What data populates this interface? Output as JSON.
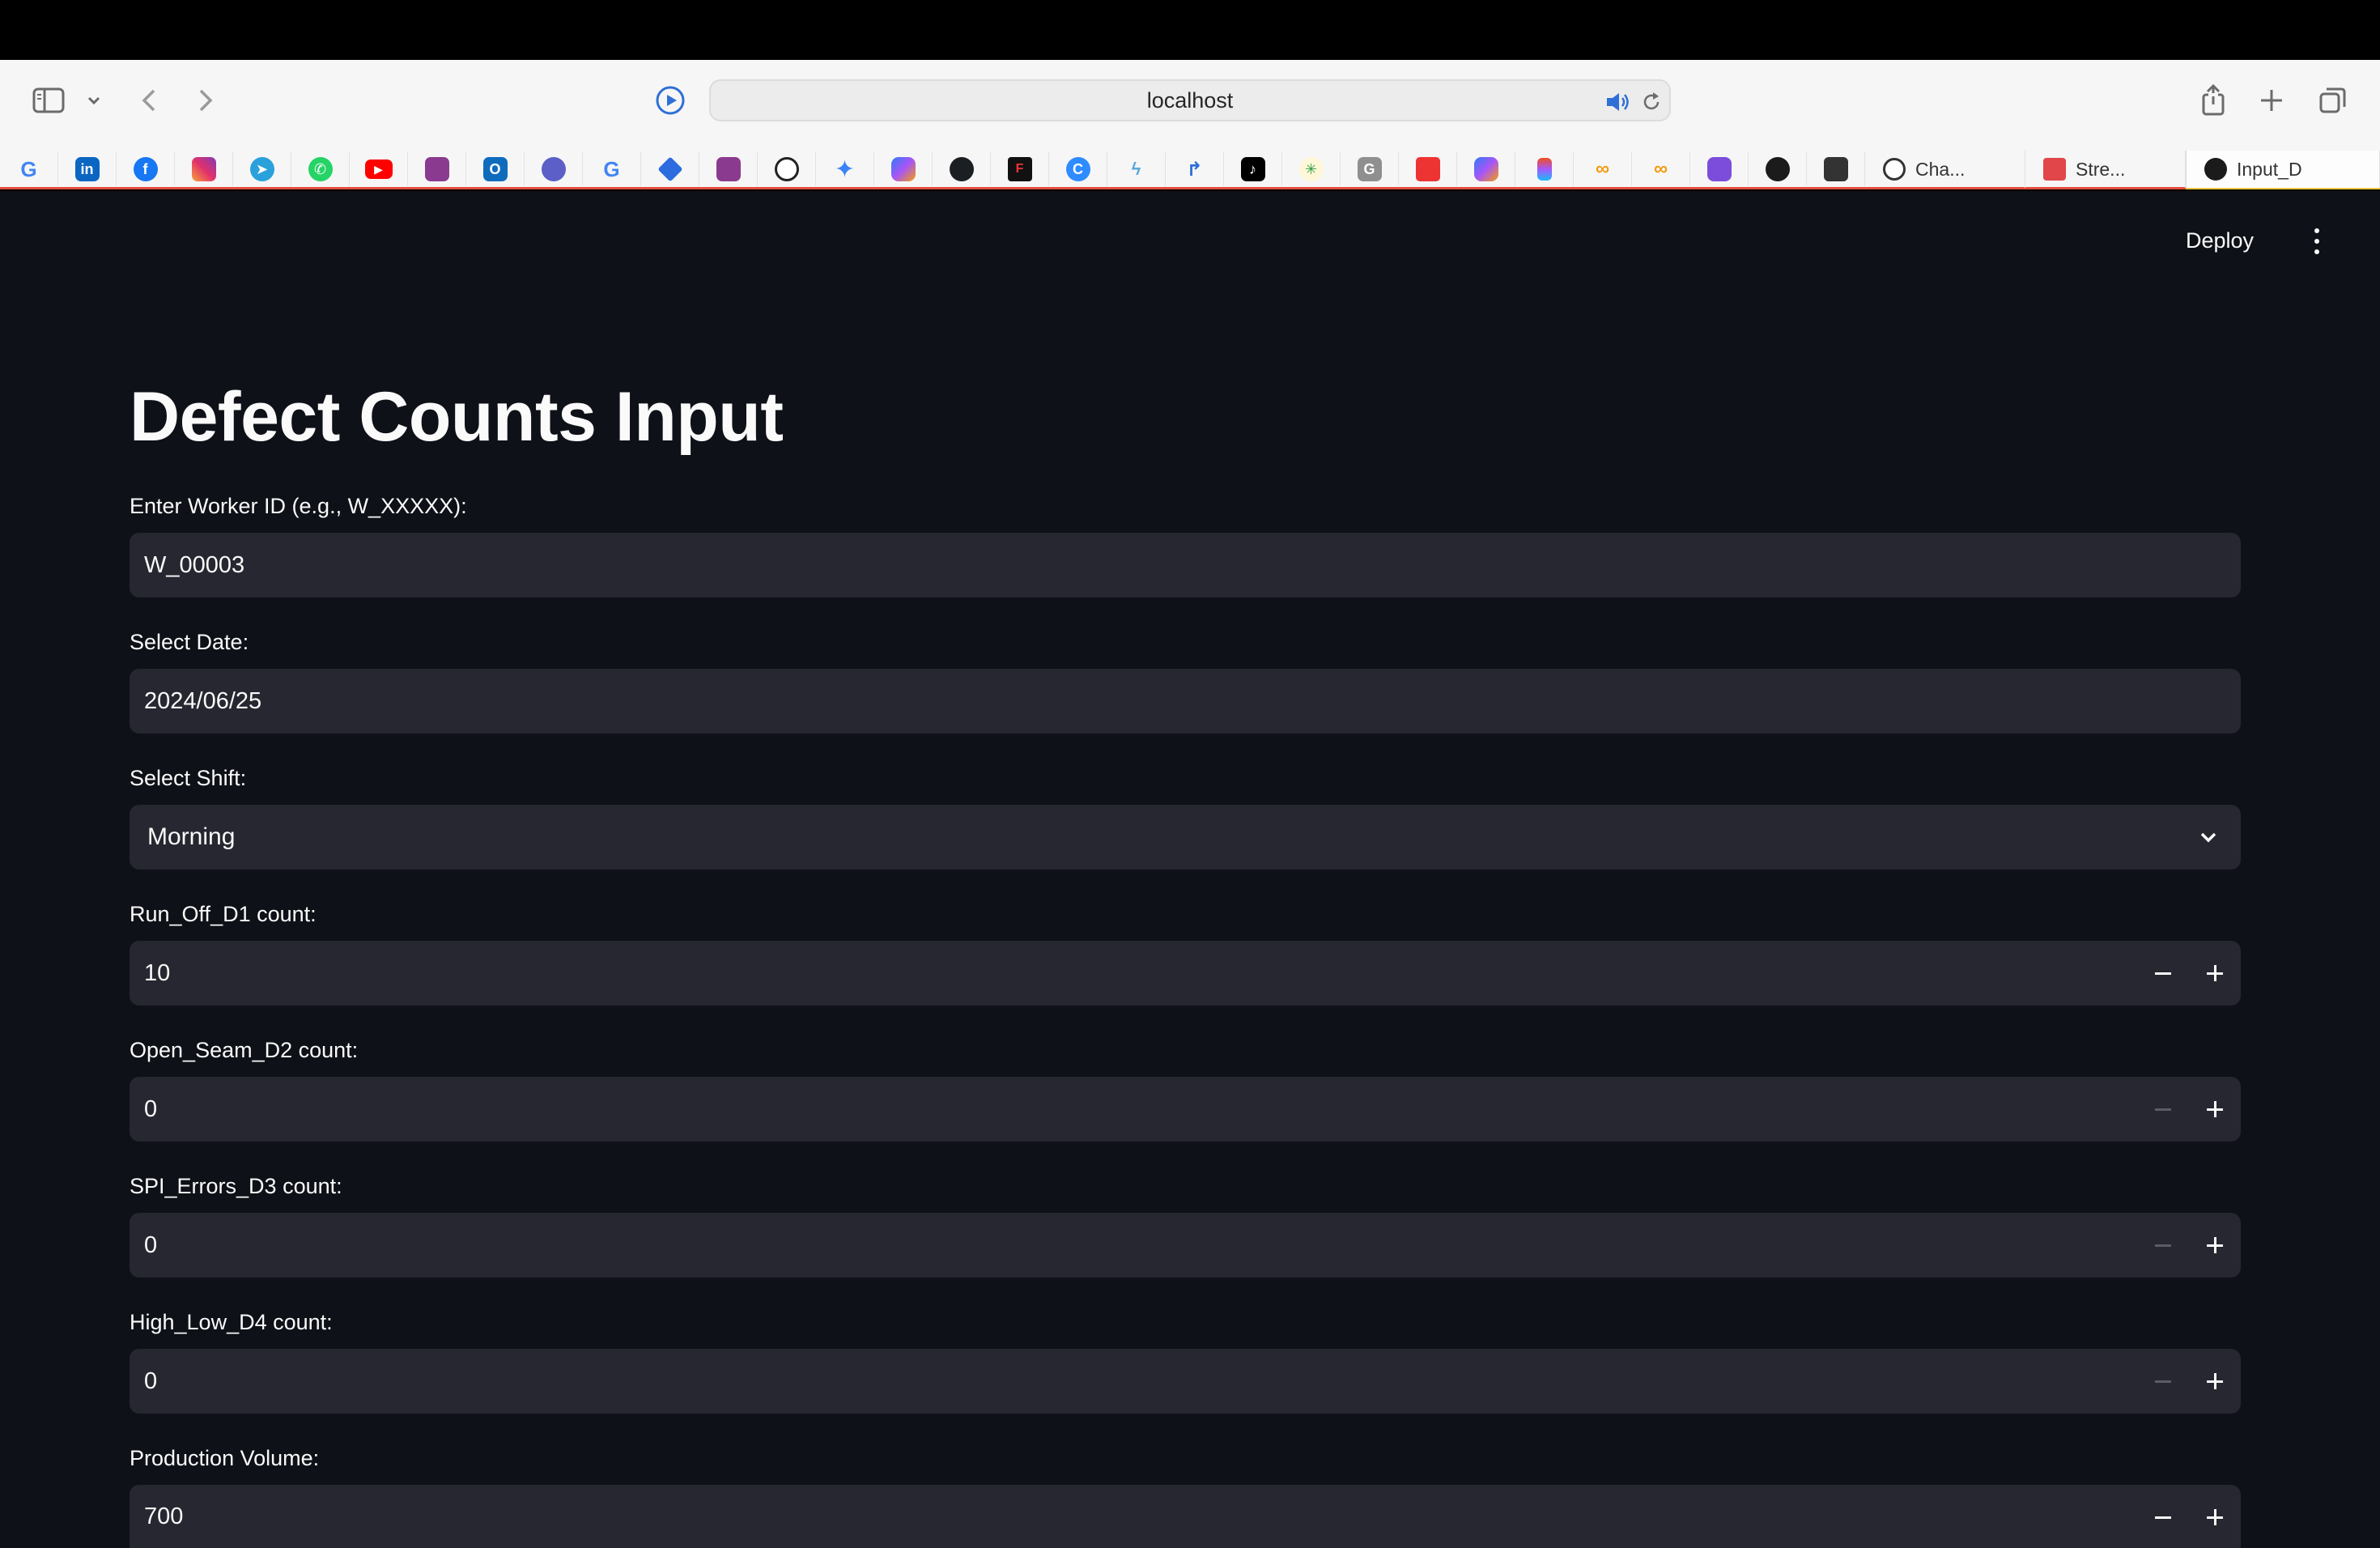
{
  "browser": {
    "url": "localhost",
    "tabs": [
      {
        "label": "Cha...",
        "icon": "openai-icon"
      },
      {
        "label": "Stre...",
        "icon": "streamlit-icon"
      },
      {
        "label": "Input_D",
        "icon": "app-icon",
        "active": true
      }
    ],
    "favicon_letters": {
      "g1": "G",
      "li": "in",
      "fb": "f",
      "g2": "G",
      "gx": "G"
    }
  },
  "header": {
    "deploy_label": "Deploy"
  },
  "form": {
    "title": "Defect Counts Input",
    "worker_id": {
      "label": "Enter Worker ID (e.g., W_XXXXX):",
      "value": "W_00003"
    },
    "date": {
      "label": "Select Date:",
      "value": "2024/06/25"
    },
    "shift": {
      "label": "Select Shift:",
      "value": "Morning"
    },
    "run_off": {
      "label": "Run_Off_D1 count:",
      "value": "10"
    },
    "open_seam": {
      "label": "Open_Seam_D2 count:",
      "value": "0"
    },
    "spi_errors": {
      "label": "SPI_Errors_D3 count:",
      "value": "0"
    },
    "high_low": {
      "label": "High_Low_D4 count:",
      "value": "0"
    },
    "production_volume": {
      "label": "Production Volume:",
      "value": "700"
    }
  },
  "colors": {
    "app_bg": "#0e1117",
    "input_bg": "#262730",
    "text": "#fafafa"
  }
}
